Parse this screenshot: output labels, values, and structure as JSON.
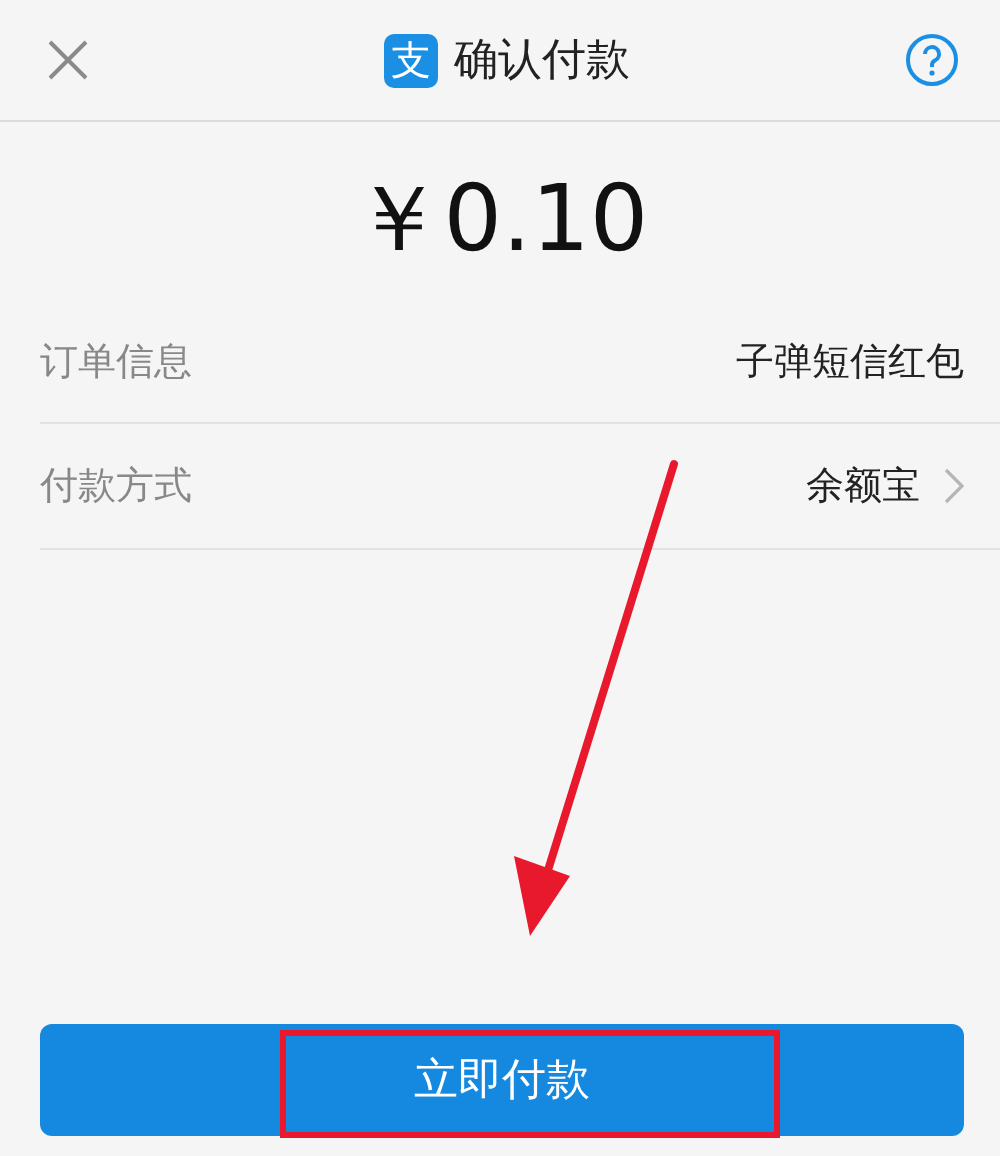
{
  "header": {
    "logo_glyph": "支",
    "title": "确认付款"
  },
  "amount": "￥0.10",
  "rows": [
    {
      "label": "订单信息",
      "value": "子弹短信红包",
      "chevron": false
    },
    {
      "label": "付款方式",
      "value": "余额宝",
      "chevron": true
    }
  ],
  "pay_button": {
    "label": "立即付款"
  }
}
